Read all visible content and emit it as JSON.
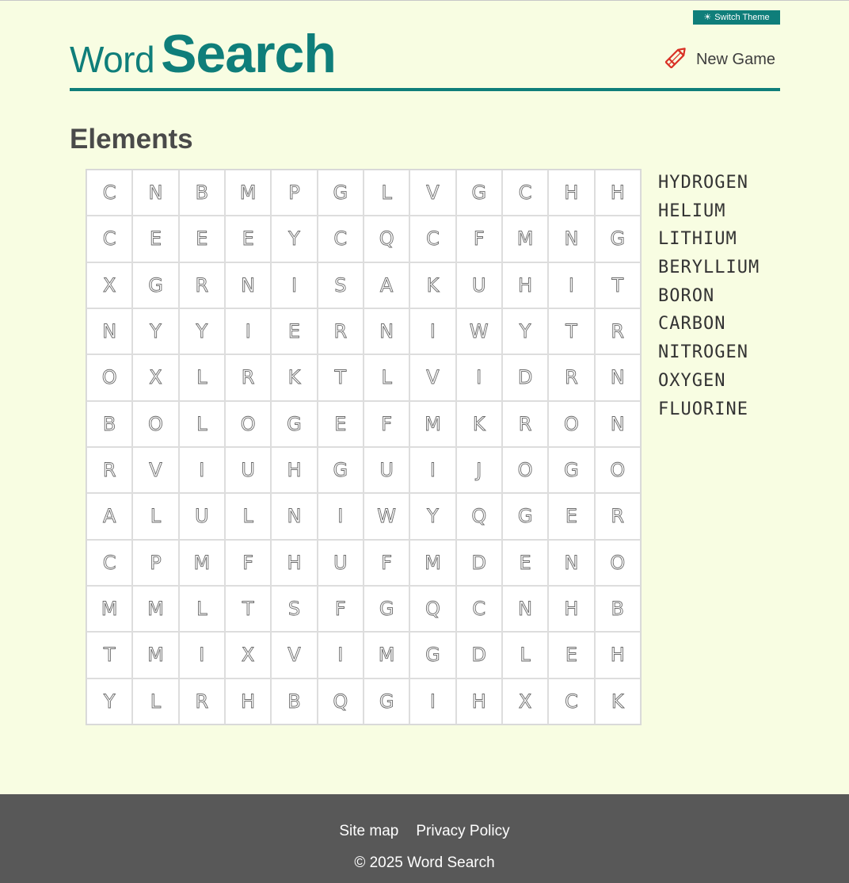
{
  "theme_button": {
    "label": "Switch Theme",
    "icon": "sun-icon"
  },
  "logo": {
    "part1": "Word",
    "part2": "Search"
  },
  "new_game": {
    "label": "New Game",
    "icon": "pencil-icon"
  },
  "puzzle": {
    "title": "Elements",
    "grid": [
      [
        "C",
        "N",
        "B",
        "M",
        "P",
        "G",
        "L",
        "V",
        "G",
        "C",
        "H",
        "H"
      ],
      [
        "C",
        "E",
        "E",
        "E",
        "Y",
        "C",
        "Q",
        "C",
        "F",
        "M",
        "N",
        "G"
      ],
      [
        "X",
        "G",
        "R",
        "N",
        "I",
        "S",
        "A",
        "K",
        "U",
        "H",
        "I",
        "T"
      ],
      [
        "N",
        "Y",
        "Y",
        "I",
        "E",
        "R",
        "N",
        "I",
        "W",
        "Y",
        "T",
        "R"
      ],
      [
        "O",
        "X",
        "L",
        "R",
        "K",
        "T",
        "L",
        "V",
        "I",
        "D",
        "R",
        "N"
      ],
      [
        "B",
        "O",
        "L",
        "O",
        "G",
        "E",
        "F",
        "M",
        "K",
        "R",
        "O",
        "N"
      ],
      [
        "R",
        "V",
        "I",
        "U",
        "H",
        "G",
        "U",
        "I",
        "J",
        "O",
        "G",
        "O"
      ],
      [
        "A",
        "L",
        "U",
        "L",
        "N",
        "I",
        "W",
        "Y",
        "Q",
        "G",
        "E",
        "R"
      ],
      [
        "C",
        "P",
        "M",
        "F",
        "H",
        "U",
        "F",
        "M",
        "D",
        "E",
        "N",
        "O"
      ],
      [
        "M",
        "M",
        "L",
        "T",
        "S",
        "F",
        "G",
        "Q",
        "C",
        "N",
        "H",
        "B"
      ],
      [
        "T",
        "M",
        "I",
        "X",
        "V",
        "I",
        "M",
        "G",
        "D",
        "L",
        "E",
        "H"
      ],
      [
        "Y",
        "L",
        "R",
        "H",
        "B",
        "Q",
        "G",
        "I",
        "H",
        "X",
        "C",
        "K"
      ]
    ],
    "words": [
      "HYDROGEN",
      "HELIUM",
      "LITHIUM",
      "BERYLLIUM",
      "BORON",
      "CARBON",
      "NITROGEN",
      "OXYGEN",
      "FLUORINE"
    ]
  },
  "footer": {
    "links": [
      "Site map",
      "Privacy Policy"
    ],
    "copyright": "© 2025 Word Search"
  },
  "colors": {
    "accent": "#0f7e7a",
    "background": "#f8fde2",
    "footer": "#585858",
    "pencil": "#d93025"
  }
}
